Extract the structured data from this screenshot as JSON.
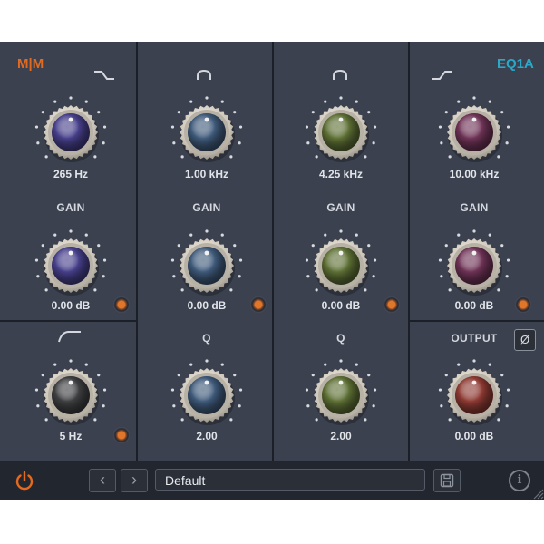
{
  "brand": {
    "left": "M|M",
    "right": "EQ1A"
  },
  "colors": {
    "panel": "#3b414e",
    "divider": "#1b1f27",
    "accent_orange": "#e06a22",
    "accent_teal": "#2ba8c8",
    "knob_low": "#463f8a",
    "knob_mid1": "#3f5a7a",
    "knob_mid2": "#5e7035",
    "knob_high": "#6e3356",
    "knob_output": "#8e3a33",
    "knob_hpf": "#3e3f41"
  },
  "bands": {
    "low": {
      "icon": "low-shelf-icon",
      "freq": "265 Hz",
      "gain_label": "GAIN",
      "gain": "0.00 dB"
    },
    "mid1": {
      "icon": "bell-icon",
      "freq": "1.00 kHz",
      "gain_label": "GAIN",
      "gain": "0.00 dB",
      "q_label": "Q",
      "q": "2.00"
    },
    "mid2": {
      "icon": "bell-icon",
      "freq": "4.25 kHz",
      "gain_label": "GAIN",
      "gain": "0.00 dB",
      "q_label": "Q",
      "q": "2.00"
    },
    "high": {
      "icon": "high-shelf-icon",
      "freq": "10.00 kHz",
      "gain_label": "GAIN",
      "gain": "0.00 dB"
    }
  },
  "hpf": {
    "icon": "high-pass-icon",
    "freq": "5 Hz"
  },
  "output": {
    "label": "OUTPUT",
    "value": "0.00 dB",
    "phase_symbol": "Ø"
  },
  "bottom": {
    "prev_symbol": "‹",
    "next_symbol": "›",
    "preset": "Default",
    "power_icon": "power-icon",
    "save_icon": "save-icon",
    "info_symbol": "i"
  }
}
